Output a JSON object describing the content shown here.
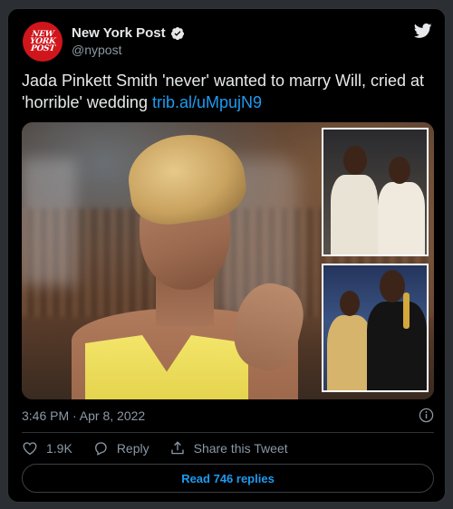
{
  "author": {
    "name": "New York Post",
    "handle": "@nypost",
    "avatar_lines": [
      "NEW",
      "YORK",
      "POST"
    ]
  },
  "tweet": {
    "text": "Jada Pinkett Smith 'never' wanted to marry Will, cried at 'horrible' wedding ",
    "link": "trib.al/uMpujN9"
  },
  "timestamp": "3:46 PM · Apr 8, 2022",
  "actions": {
    "likes": "1.9K",
    "reply_label": "Reply",
    "share_label": "Share this Tweet"
  },
  "read_replies": "Read 746 replies",
  "colors": {
    "background": "#000000",
    "text": "#e7e9ea",
    "muted": "#8b98a5",
    "accent": "#1d9bf0",
    "avatar": "#d0161c"
  },
  "icons": [
    "verified-badge-icon",
    "twitter-bird-icon",
    "info-icon",
    "heart-icon",
    "reply-icon",
    "share-icon"
  ]
}
